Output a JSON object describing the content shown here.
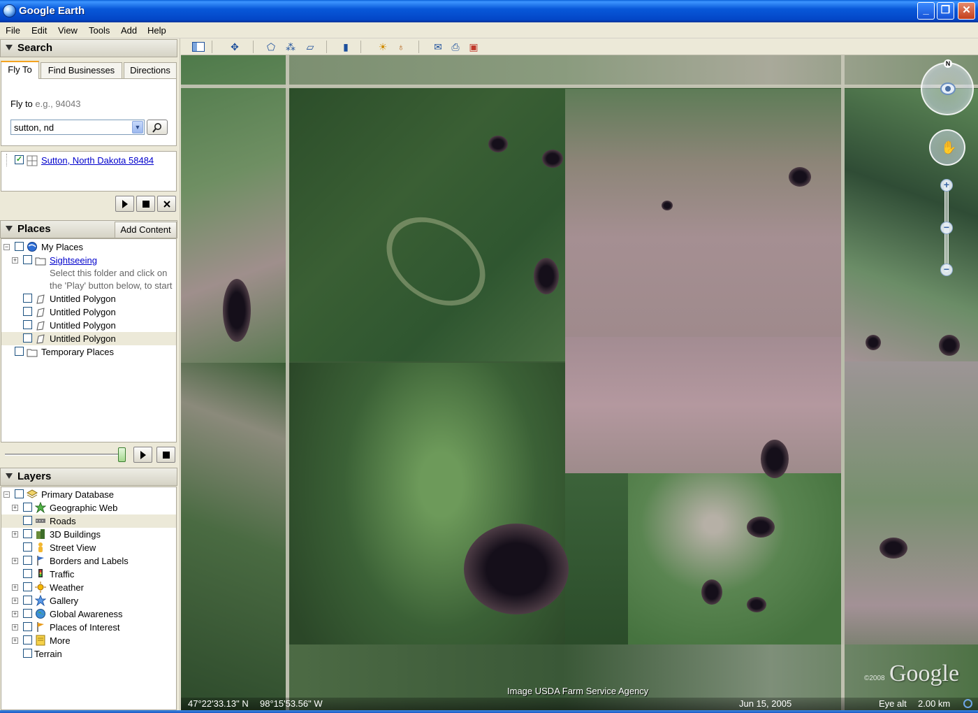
{
  "window": {
    "title": "Google Earth",
    "controls": {
      "minimize": "_",
      "maximize": "❐",
      "close": "✕"
    }
  },
  "menu": [
    "File",
    "Edit",
    "View",
    "Tools",
    "Add",
    "Help"
  ],
  "search": {
    "header": "Search",
    "tabs": [
      "Fly To",
      "Find Businesses",
      "Directions"
    ],
    "flyto_label": "Fly to",
    "flyto_hint": "e.g., 94043",
    "query": "sutton, nd",
    "result": "Sutton, North Dakota 58484"
  },
  "places": {
    "header": "Places",
    "add_content": "Add Content",
    "items": [
      {
        "label": "My Places",
        "type": "folder-earth"
      },
      {
        "label": "Sightseeing",
        "type": "folder",
        "link": true
      },
      {
        "label": "Select this folder and click on",
        "type": "note"
      },
      {
        "label": "the 'Play' button below, to start",
        "type": "note"
      },
      {
        "label": "Untitled Polygon",
        "type": "polygon"
      },
      {
        "label": "Untitled Polygon",
        "type": "polygon"
      },
      {
        "label": "Untitled Polygon",
        "type": "polygon"
      },
      {
        "label": "Untitled Polygon",
        "type": "polygon"
      },
      {
        "label": "Temporary Places",
        "type": "folder"
      }
    ]
  },
  "layers": {
    "header": "Layers",
    "items": [
      {
        "label": "Primary Database",
        "icon": "database-icon"
      },
      {
        "label": "Geographic Web",
        "icon": "star-icon"
      },
      {
        "label": "Roads",
        "icon": "road-icon"
      },
      {
        "label": "3D Buildings",
        "icon": "buildings-icon"
      },
      {
        "label": "Street View",
        "icon": "person-icon"
      },
      {
        "label": "Borders and Labels",
        "icon": "flag-icon"
      },
      {
        "label": "Traffic",
        "icon": "traffic-light-icon"
      },
      {
        "label": "Weather",
        "icon": "sun-icon"
      },
      {
        "label": "Gallery",
        "icon": "star-icon"
      },
      {
        "label": "Global Awareness",
        "icon": "globe-icon"
      },
      {
        "label": "Places of Interest",
        "icon": "flag-icon"
      },
      {
        "label": "More",
        "icon": "note-icon"
      },
      {
        "label": "Terrain",
        "icon": ""
      }
    ]
  },
  "map": {
    "credit": "Image USDA Farm Service Agency",
    "logo": "Google",
    "copyright_year": "©2008",
    "compass_n": "N"
  },
  "status": {
    "latitude": "47°22'33.13\" N",
    "longitude": "98°15'53.56\" W",
    "date": "Jun 15, 2005",
    "eye_alt_label": "Eye alt",
    "eye_alt_value": "2.00 km"
  }
}
